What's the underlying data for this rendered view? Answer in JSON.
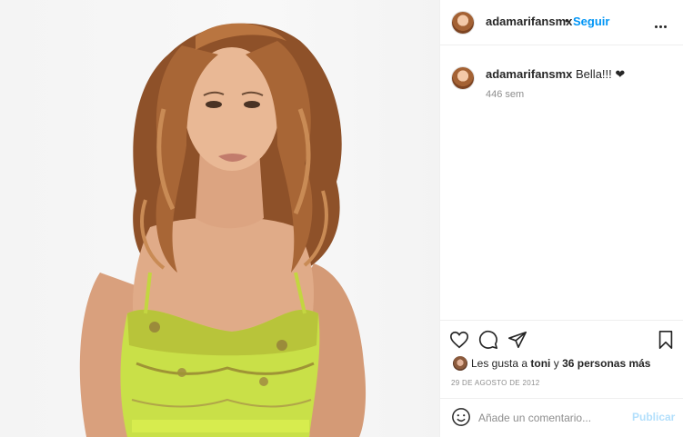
{
  "header": {
    "username": "adamarifansmx",
    "separator": "•",
    "follow_label": "Seguir",
    "more_icon": "more-horizontal-icon"
  },
  "caption": {
    "username": "adamarifansmx",
    "text": "Bella!!! ❤",
    "age": "446 sem"
  },
  "actions": {
    "like_icon": "heart-icon",
    "comment_icon": "comment-bubble-icon",
    "share_icon": "paper-plane-icon",
    "save_icon": "bookmark-icon"
  },
  "likes": {
    "prefix": "Les gusta a",
    "first_user": "toni",
    "connector": "y",
    "others": "36 personas más"
  },
  "date": "29 DE AGOSTO DE 2012",
  "comment_box": {
    "placeholder": "Añade un comentario...",
    "post_label": "Publicar"
  },
  "photo": {
    "description_icon": "post-photo",
    "dress_color": "#c9e048",
    "hair_color": "#9a5a2e"
  }
}
